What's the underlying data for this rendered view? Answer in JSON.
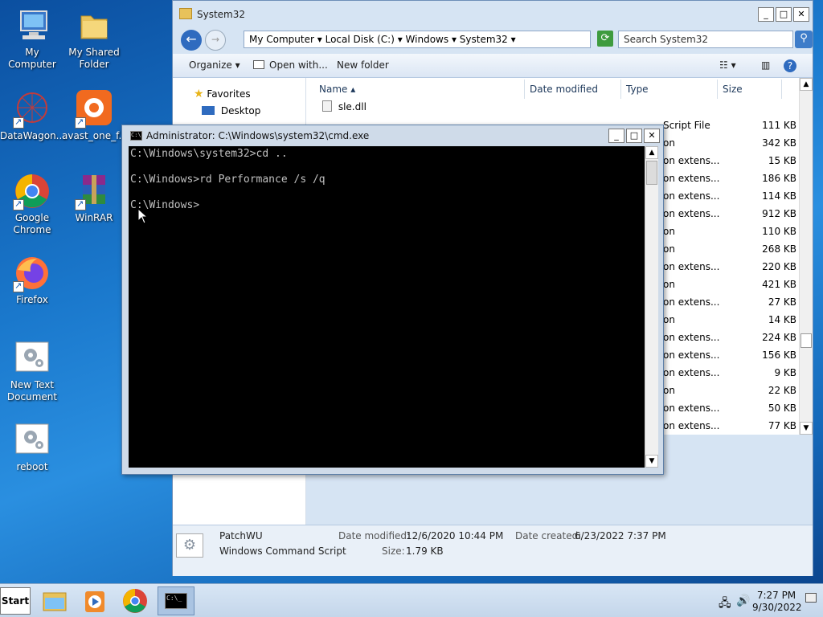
{
  "desktop": {
    "icons": [
      {
        "label": "My Computer"
      },
      {
        "label": "My Shared Folder"
      },
      {
        "label": "DataWagon..."
      },
      {
        "label": "avast_one_f..."
      },
      {
        "label": "Google Chrome"
      },
      {
        "label": "WinRAR"
      },
      {
        "label": "Firefox"
      },
      {
        "label": "New Text Document"
      },
      {
        "label": "reboot"
      }
    ]
  },
  "explorer": {
    "title": "System32",
    "breadcrumb": [
      "My Computer",
      "Local Disk (C:)",
      "Windows",
      "System32"
    ],
    "search_placeholder": "Search System32",
    "toolbar": {
      "organize": "Organize",
      "open_with": "Open with...",
      "new_folder": "New folder"
    },
    "nav": {
      "favorites": "Favorites",
      "desktop": "Desktop"
    },
    "columns": {
      "name": "Name",
      "date": "Date modified",
      "type": "Type",
      "size": "Size"
    },
    "first_file": "sle.dll",
    "rows": [
      {
        "type": "Script File",
        "size": "111 KB"
      },
      {
        "type": "on",
        "size": "342 KB"
      },
      {
        "type": "on extens...",
        "size": "15 KB"
      },
      {
        "type": "on extens...",
        "size": "186 KB"
      },
      {
        "type": "on extens...",
        "size": "114 KB"
      },
      {
        "type": "on extens...",
        "size": "912 KB"
      },
      {
        "type": "on",
        "size": "110 KB"
      },
      {
        "type": "on",
        "size": "268 KB"
      },
      {
        "type": "on extens...",
        "size": "220 KB"
      },
      {
        "type": "on",
        "size": "421 KB"
      },
      {
        "type": "on extens...",
        "size": "27 KB"
      },
      {
        "type": "on",
        "size": "14 KB"
      },
      {
        "type": "on extens...",
        "size": "224 KB"
      },
      {
        "type": "on extens...",
        "size": "156 KB"
      },
      {
        "type": "on extens...",
        "size": "9 KB"
      },
      {
        "type": "on",
        "size": "22 KB"
      },
      {
        "type": "on extens...",
        "size": "50 KB"
      },
      {
        "type": "on extens...",
        "size": "77 KB"
      }
    ],
    "details": {
      "name": "PatchWU",
      "kind": "Windows Command Script",
      "modified_label": "Date modified:",
      "modified": "12/6/2020 10:44 PM",
      "created_label": "Date created:",
      "created": "6/23/2022 7:37 PM",
      "size_label": "Size:",
      "size": "1.79 KB"
    }
  },
  "cmd": {
    "title": "Administrator: C:\\Windows\\system32\\cmd.exe",
    "output": "C:\\Windows\\system32>cd ..\n\nC:\\Windows>rd Performance /s /q\n\nC:\\Windows>"
  },
  "taskbar": {
    "start": "Start",
    "time": "7:27 PM",
    "date": "9/30/2022"
  }
}
